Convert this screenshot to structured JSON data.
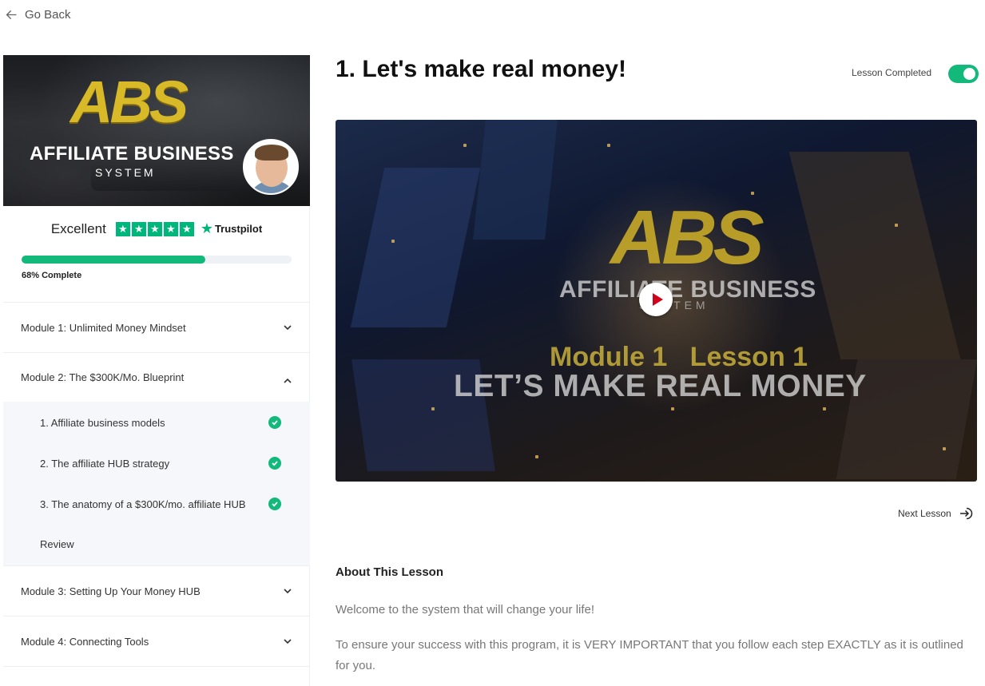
{
  "nav": {
    "go_back": "Go Back"
  },
  "sidebar": {
    "banner": {
      "logo": "ABS",
      "title": "AFFILIATE BUSINESS",
      "subtitle": "SYSTEM"
    },
    "rating": {
      "label": "Excellent",
      "stars": 5,
      "brand": "Trustpilot"
    },
    "progress": {
      "percent": 68,
      "label": "68% Complete"
    },
    "modules": [
      {
        "label": "Module 1: Unlimited Money Mindset",
        "expanded": false
      },
      {
        "label": "Module 2: The $300K/Mo. Blueprint",
        "expanded": true
      },
      {
        "label": "Module 3: Setting Up Your Money HUB",
        "expanded": false
      },
      {
        "label": "Module 4: Connecting Tools",
        "expanded": false
      }
    ],
    "lessons": [
      {
        "label": "1. Affiliate business models",
        "completed": true
      },
      {
        "label": "2. The affiliate HUB strategy",
        "completed": true
      },
      {
        "label": "3. The anatomy of a $300K/mo. affiliate HUB",
        "completed": true
      },
      {
        "label": "Review",
        "completed": false
      }
    ]
  },
  "main": {
    "title": "1. Let's make real money!",
    "completed_label": "Lesson Completed",
    "completed": true,
    "video": {
      "logo": "ABS",
      "brand_title": "AFFILIATE BUSINESS",
      "brand_sub": "SYSTEM",
      "module_line": "Module 1   Lesson 1",
      "lesson_line": "LET’S MAKE REAL MONEY"
    },
    "next_label": "Next Lesson",
    "about": {
      "heading": "About This Lesson",
      "p1": "Welcome to the system that will change your life!",
      "p2": "To ensure your success with this program, it is VERY IMPORTANT that you follow each step EXACTLY as it is outlined for you."
    }
  },
  "colors": {
    "accent": "#12b97b",
    "trustpilot": "#00b67a",
    "play": "#d0021b"
  }
}
